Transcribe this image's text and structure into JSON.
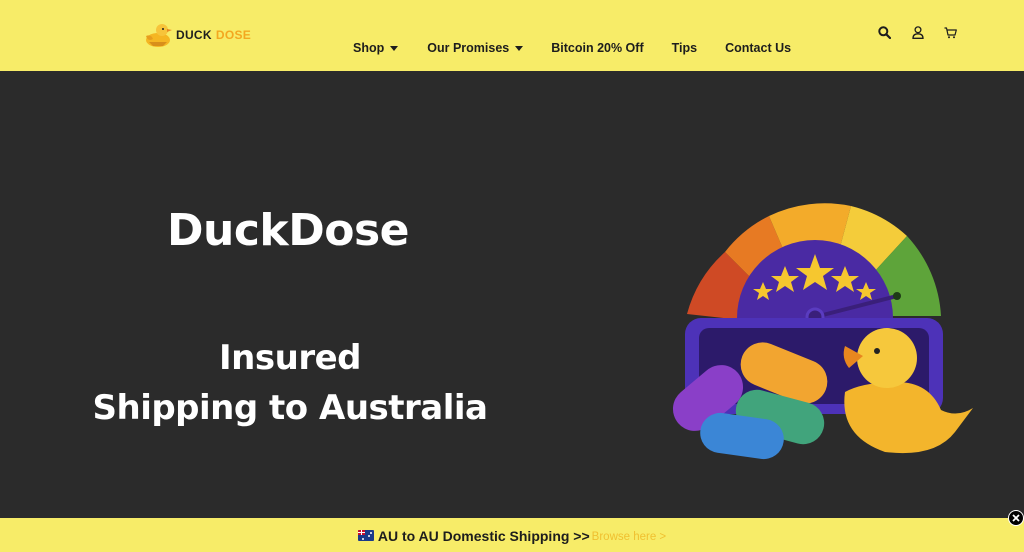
{
  "header": {
    "logo": {
      "word1": "DUCK",
      "word2": "DOSE",
      "icon": "duck-logo-icon"
    },
    "nav": [
      {
        "label": "Shop",
        "has_dropdown": true
      },
      {
        "label": "Our Promises",
        "has_dropdown": true
      },
      {
        "label": "Bitcoin 20% Off",
        "has_dropdown": false
      },
      {
        "label": "Tips",
        "has_dropdown": false
      },
      {
        "label": "Contact Us",
        "has_dropdown": false
      }
    ],
    "icons": [
      "search-icon",
      "user-icon",
      "cart-icon"
    ]
  },
  "hero": {
    "title": "DuckDose",
    "subtitle_line1": "Insured",
    "subtitle_line2": "Shipping to Australia",
    "illustration": "rating-gauge-pills-duck-illustration"
  },
  "banner": {
    "flag_icon": "australia-flag-icon",
    "text": "AU to AU Domestic Shipping >>",
    "link": "Browse here >"
  },
  "colors": {
    "header_bg": "#f7ec68",
    "hero_bg": "#2b2b2b",
    "link": "#f0c030",
    "accent": "#f3a820"
  }
}
